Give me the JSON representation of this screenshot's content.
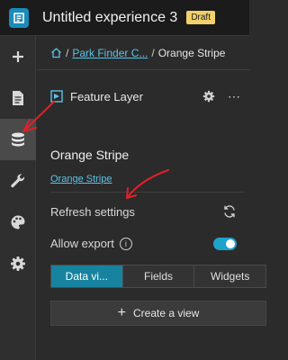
{
  "app": {
    "title": "Untitled experience 3",
    "status_badge": "Draft"
  },
  "rail": {
    "items": [
      {
        "icon": "plus-icon"
      },
      {
        "icon": "page-icon"
      },
      {
        "icon": "database-icon",
        "active": true
      },
      {
        "icon": "wrench-icon"
      },
      {
        "icon": "palette-icon"
      },
      {
        "icon": "gear-icon"
      }
    ]
  },
  "breadcrumb": {
    "parent": "Park Finder C...",
    "separator": "/",
    "current": "Orange Stripe"
  },
  "layer": {
    "type_label": "Feature Layer",
    "name": "Orange Stripe",
    "source_link": "Orange Stripe",
    "more_symbol": "⋯"
  },
  "settings": {
    "refresh_label": "Refresh settings",
    "allow_export_label": "Allow export",
    "info_symbol": "i",
    "allow_export_on": true
  },
  "tabs": [
    {
      "label": "Data vi...",
      "active": true
    },
    {
      "label": "Fields",
      "active": false
    },
    {
      "label": "Widgets",
      "active": false
    }
  ],
  "create_view": {
    "plus": "+",
    "label": "Create a view"
  },
  "colors": {
    "accent": "#1ea3c9",
    "link": "#5cc3e6",
    "badge": "#f2d06b",
    "annotation": "#e0202a"
  }
}
